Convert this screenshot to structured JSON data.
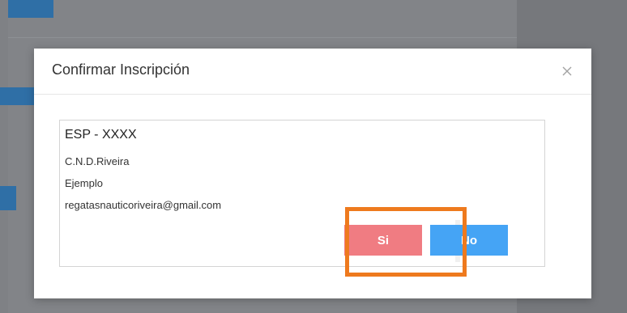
{
  "modal": {
    "title": "Confirmar Inscripción",
    "close_icon": "close-icon",
    "code": "ESP - XXXX",
    "club": "C.N.D.Riveira",
    "name": "Ejemplo",
    "email": "regatasnauticoriveira@gmail.com",
    "buttons": {
      "yes_label": "Si",
      "no_label": "No"
    }
  },
  "colors": {
    "yes_button": "#f07c82",
    "no_button": "#45a4f5",
    "highlight": "#ee7a1e",
    "background_button": "#2f6fa6"
  }
}
